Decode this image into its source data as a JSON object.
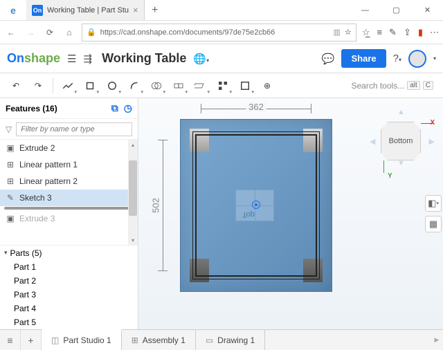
{
  "browser": {
    "tab_title": "Working Table | Part Stu",
    "url": "https://cad.onshape.com/documents/97de75e2cb66"
  },
  "header": {
    "logo_on": "On",
    "logo_shape": "shape",
    "doc_title": "Working Table",
    "share": "Share"
  },
  "toolbar": {
    "search_placeholder": "Search tools...",
    "kbd_alt": "alt",
    "kbd_c": "C"
  },
  "sidebar": {
    "features_label": "Features",
    "features_count": "(16)",
    "filter_placeholder": "Filter by name or type",
    "items": [
      {
        "label": "Extrude 2",
        "icon": "extrude"
      },
      {
        "label": "Linear pattern 1",
        "icon": "pattern"
      },
      {
        "label": "Linear pattern 2",
        "icon": "pattern"
      },
      {
        "label": "Sketch 3",
        "icon": "sketch",
        "selected": true
      }
    ],
    "dim_item": "Extrude 3",
    "parts_label": "Parts",
    "parts_count": "(5)",
    "parts": [
      "Part 1",
      "Part 2",
      "Part 3",
      "Part 4",
      "Part 5"
    ]
  },
  "canvas": {
    "dim_h": "362",
    "dim_v": "502",
    "ghost_label": "Top",
    "view_cube_face": "Bottom",
    "axis_x": "X",
    "axis_y": "Y"
  },
  "tabs": {
    "menu": "≡",
    "add": "+",
    "items": [
      {
        "label": "Part Studio 1",
        "active": true
      },
      {
        "label": "Assembly 1"
      },
      {
        "label": "Drawing 1"
      }
    ]
  }
}
